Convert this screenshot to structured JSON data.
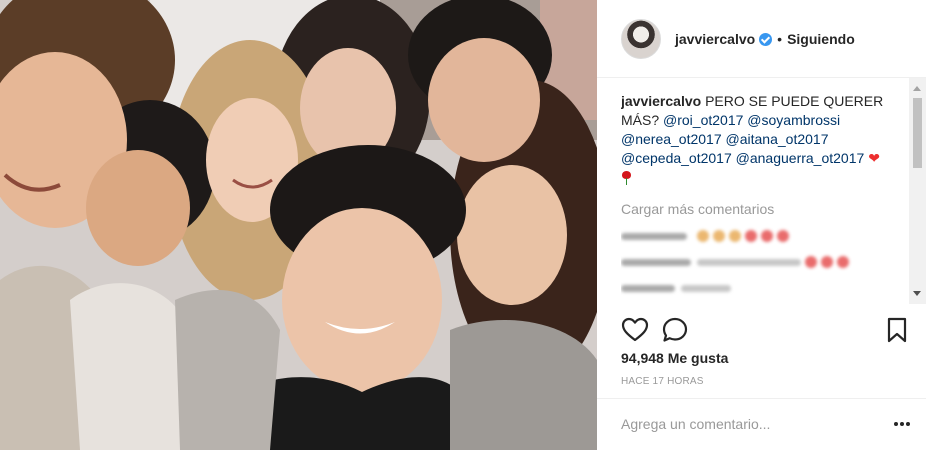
{
  "post": {
    "username": "javviercalvo",
    "follow_status": "Siguiendo",
    "separator": "•",
    "caption": {
      "user": "javviercalvo",
      "text": "PERO SE PUEDE QUERER MÁS?",
      "mentions": [
        "@roi_ot2017",
        "@soyambrossi",
        "@nerea_ot2017",
        "@aitana_ot2017",
        "@cepeda_ot2017",
        "@anaguerra_ot2017"
      ]
    },
    "load_more_label": "Cargar más comentarios",
    "likes_label": "94,948 Me gusta",
    "time_label": "HACE 17 HORAS",
    "comment_placeholder": "Agrega un comentario..."
  },
  "icons": {
    "verified": "verified-badge-icon",
    "like": "heart-outline-icon",
    "comment": "speech-bubble-icon",
    "save": "bookmark-icon",
    "more": "more-options-icon",
    "caption_emoji_1": "red-heart-emoji",
    "caption_emoji_2": "rose-emoji"
  },
  "colors": {
    "mention": "#003569",
    "verified": "#3897f0",
    "muted": "#999999",
    "text": "#262626"
  }
}
